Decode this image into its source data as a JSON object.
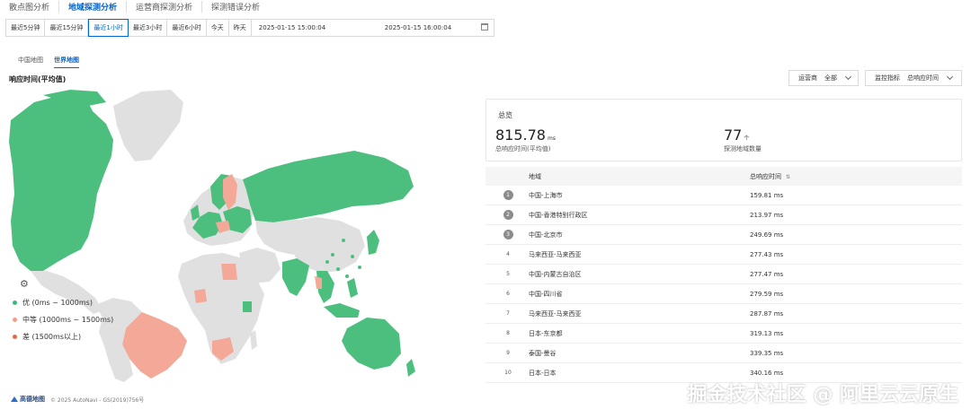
{
  "top_tabs": [
    {
      "label": "散点图分析",
      "active": false
    },
    {
      "label": "地域探测分析",
      "active": true
    },
    {
      "label": "运营商探测分析",
      "active": false
    },
    {
      "label": "探测错误分析",
      "active": false
    }
  ],
  "time_range": {
    "buttons": [
      "最近5分钟",
      "最近15分钟",
      "最近1小时",
      "最近3小时",
      "最近6小时",
      "今天",
      "昨天"
    ],
    "active": "最近1小时",
    "start": "2025-01-15 15:00:04",
    "end": "2025-01-15 16:00:04"
  },
  "map_tabs": [
    {
      "label": "中国地图",
      "active": false
    },
    {
      "label": "世界地图",
      "active": true
    }
  ],
  "section_title": "响应时间(平均值)",
  "filters": {
    "operator_label": "运营商",
    "operator_value": "全部",
    "metric_label": "监控指标",
    "metric_value": "总响应时间"
  },
  "legend": [
    {
      "label": "优 (0ms ~ 1000ms)",
      "color": "#3dba78"
    },
    {
      "label": "中等 (1000ms ~ 1500ms)",
      "color": "#f29d8c"
    },
    {
      "label": "差 (1500ms以上)",
      "color": "#e8694a"
    }
  ],
  "map_colors": {
    "good": "#4cbf7f",
    "medium": "#f4a898",
    "none": "#e0e0e0"
  },
  "attribution": {
    "logo_text": "高德地图",
    "copyright": "© 2025 AutoNavi - GS(2019)756号"
  },
  "summary": {
    "title": "总览",
    "avg_response": {
      "value": "815.78",
      "unit": "ms",
      "label": "总响应时间(平均值)"
    },
    "regions": {
      "value": "77",
      "unit": "个",
      "label": "探测地域数量"
    }
  },
  "table": {
    "headers": {
      "region": "地域",
      "time": "总响应时间"
    },
    "rows": [
      {
        "rank": "1",
        "region": "中国-上海市",
        "time": "159.81 ms"
      },
      {
        "rank": "2",
        "region": "中国-香港特别行政区",
        "time": "213.97 ms"
      },
      {
        "rank": "3",
        "region": "中国-北京市",
        "time": "249.69 ms"
      },
      {
        "rank": "4",
        "region": "马来西亚-马来西亚",
        "time": "277.43 ms"
      },
      {
        "rank": "5",
        "region": "中国-内蒙古自治区",
        "time": "277.47 ms"
      },
      {
        "rank": "6",
        "region": "中国-四川省",
        "time": "279.59 ms"
      },
      {
        "rank": "7",
        "region": "马来西亚-马来西亚",
        "time": "287.87 ms"
      },
      {
        "rank": "8",
        "region": "日本-东京都",
        "time": "319.13 ms"
      },
      {
        "rank": "9",
        "region": "泰国-曼谷",
        "time": "339.35 ms"
      },
      {
        "rank": "10",
        "region": "日本-日本",
        "time": "340.16 ms"
      }
    ]
  },
  "watermark": "掘金技术社区 @ 阿里云云原生"
}
